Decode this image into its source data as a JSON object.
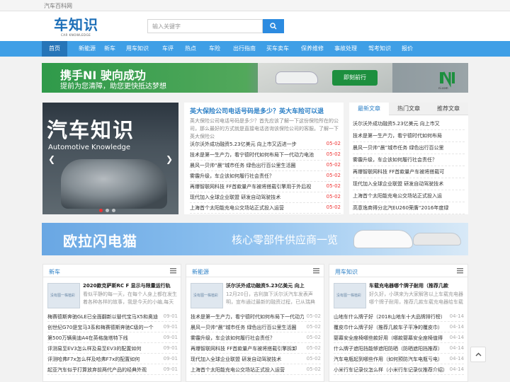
{
  "site": {
    "top_label": "汽车百科网",
    "logo_text": "车知识",
    "logo_sub": "CAR KNOWLEDGE"
  },
  "search": {
    "placeholder": "输入关键字"
  },
  "nav": [
    "首页",
    "新能源",
    "新车",
    "用车知识",
    "车评",
    "热点",
    "车险",
    "出行指南",
    "买车卖车",
    "保养维修",
    "事故处理",
    "驾考知识",
    "报价"
  ],
  "banner1": {
    "title": "携手NI 驶向成功",
    "subtitle": "提前为您清障，助您更快抵达梦想",
    "cta": "即刻前行",
    "brand": "ni.com"
  },
  "hero": {
    "title": "汽车知识",
    "subtitle": "Automotive Knowledge"
  },
  "middle": {
    "headline": "英大保险公司电话号码是多少？英大车险可以退",
    "desc": "英大保险公司电话号码是多少？首先应该了解一下这份保险所在的公司，那么最好的方式就是直接电话咨询该保险公司的客服。了解一下英大保险公",
    "list": [
      {
        "title": "沃尔沃外成功融资5.23亿美元 向上市又迈进一步",
        "date": "05-02"
      },
      {
        "title": "技术是第一生产力，看宁德时代如何布局下一代动力电池",
        "date": "05-02"
      },
      {
        "title": "晨风一贝帅“晨”城市任务 绿色出行百公里生活圈",
        "date": "05-02"
      },
      {
        "title": "雾霾升级，车企该如何履行社会责任？",
        "date": "05-02"
      },
      {
        "title": "再爆智联网科技 FF首款量产车被将搭载引擎用于外后视",
        "date": "05-02"
      },
      {
        "title": "现代加入全球企业联盟 研发自动驾驶技术",
        "date": "05-02"
      },
      {
        "title": "上海首个太阳能充电公交场站正式投入运营",
        "date": "05-02"
      }
    ]
  },
  "right": {
    "tabs": [
      "最新文章",
      "热门文章",
      "推荐文章"
    ],
    "list": [
      "沃尔沃外成功融资5.23亿美元 向上市又",
      "技术是第一生产力，看宁德时代如何布局",
      "晨风一贝帅“晨”城市任务 绿色出行百公里",
      "雾霾升级，车企该如何履行社会责任？",
      "再爆智联网科技 FF首款量产车被将搭载可",
      "现代加入全球企业联盟 研发自动驾驶技术",
      "上海首个太阳能充电公交场站正式投入运",
      "高意逸商得分北汽EU260荣膺“2016年度绿"
    ]
  },
  "banner2": {
    "left": "欧拉闪电猫",
    "right": "核心零部件供应商一览"
  },
  "panels": [
    {
      "title": "新车",
      "feature_title": "2020款克萨斯RC F 显示与限量运行轨",
      "feature_desc": "看似平静的每一天，在每个人身上都在发生着各种各样的故事，我是今天的小编,每天",
      "thumb": "没有图一株植彩",
      "items": [
        {
          "t": "梅赛德斯奔驰GLE已全面翻新以替代宝马X5和奥迪",
          "d": "09-01"
        },
        {
          "t": "创世纪G70是宝马3系和梅赛德斯奔驰C级的一个",
          "d": "09-01"
        },
        {
          "t": "第500万辆奥迪A4在英格施塔特下线",
          "d": "09-01"
        },
        {
          "t": "评测易至EV3怎么样及易至EV3的配置如何",
          "d": "09-01"
        },
        {
          "t": "评测哈弗F7x怎么样及哈弗F7x的配置如何",
          "d": "09-01"
        },
        {
          "t": "起亚汽车似乎打算放弃前两代产品的经典外观",
          "d": "09-01"
        }
      ]
    },
    {
      "title": "新能源",
      "feature_title": "沃尔沃外成功融资5.23亿美元 向上",
      "feature_desc": "12月20日，吉利旗下沃尔沃汽车发表声明，宣布通过最新的融资过程，已从瑞典",
      "thumb": "没有图一株植彩",
      "items": [
        {
          "t": "技术是第一生产力，看宁德时代如何布局下一代动力",
          "d": "05-02"
        },
        {
          "t": "晨风一贝帅“晨”城市任务 绿色出行百公里生活圈",
          "d": "05-02"
        },
        {
          "t": "雾霾升级，车企该如何履行社会责任？",
          "d": "05-02"
        },
        {
          "t": "再爆智联网科技 FF首款量产车被将搭载引擎拆卸",
          "d": "05-02"
        },
        {
          "t": "现代加入全球企业联盟 研发自动驾驶技术",
          "d": "05-02"
        },
        {
          "t": "上海首个太阳能充电公交场站正式投入运营",
          "d": "05-02"
        }
      ]
    },
    {
      "title": "用车知识",
      "feature_title": "车载充电器哪个牌子耐用（推荐几款",
      "feature_desc": "好久好，小琪来为大家解答以上车载充电器哪个牌子耐用，推荐几款车载充电器给车载充电",
      "thumb": "没有图一株植彩",
      "items": [
        {
          "t": "山地车什么牌子好（2018山地车十大品牌排行榜）",
          "d": "04-14"
        },
        {
          "t": "覆皮巾什么牌子好（推荐几款车子平净的覆皮巾）",
          "d": "04-14"
        },
        {
          "t": "婴幕安全座椅哪些款好用（哪款婴幕安全座椅值得",
          "d": "04-14"
        },
        {
          "t": "什么牌子遮阳挡能够遮阳防晒（防晒遮阳挡推荐）",
          "d": "04-14"
        },
        {
          "t": "汽车电瓶起到哪些作用（如何预防汽车电瓶亏电）",
          "d": "04-14"
        },
        {
          "t": "小米行车记录仪怎么样（小米行车记录仪推荐介绍）",
          "d": "04-14"
        }
      ]
    }
  ],
  "colors": {
    "accent": "#3f9fe6",
    "nav_active": "#2675b8",
    "link": "#2b7fc6",
    "date_red": "#e33333"
  }
}
